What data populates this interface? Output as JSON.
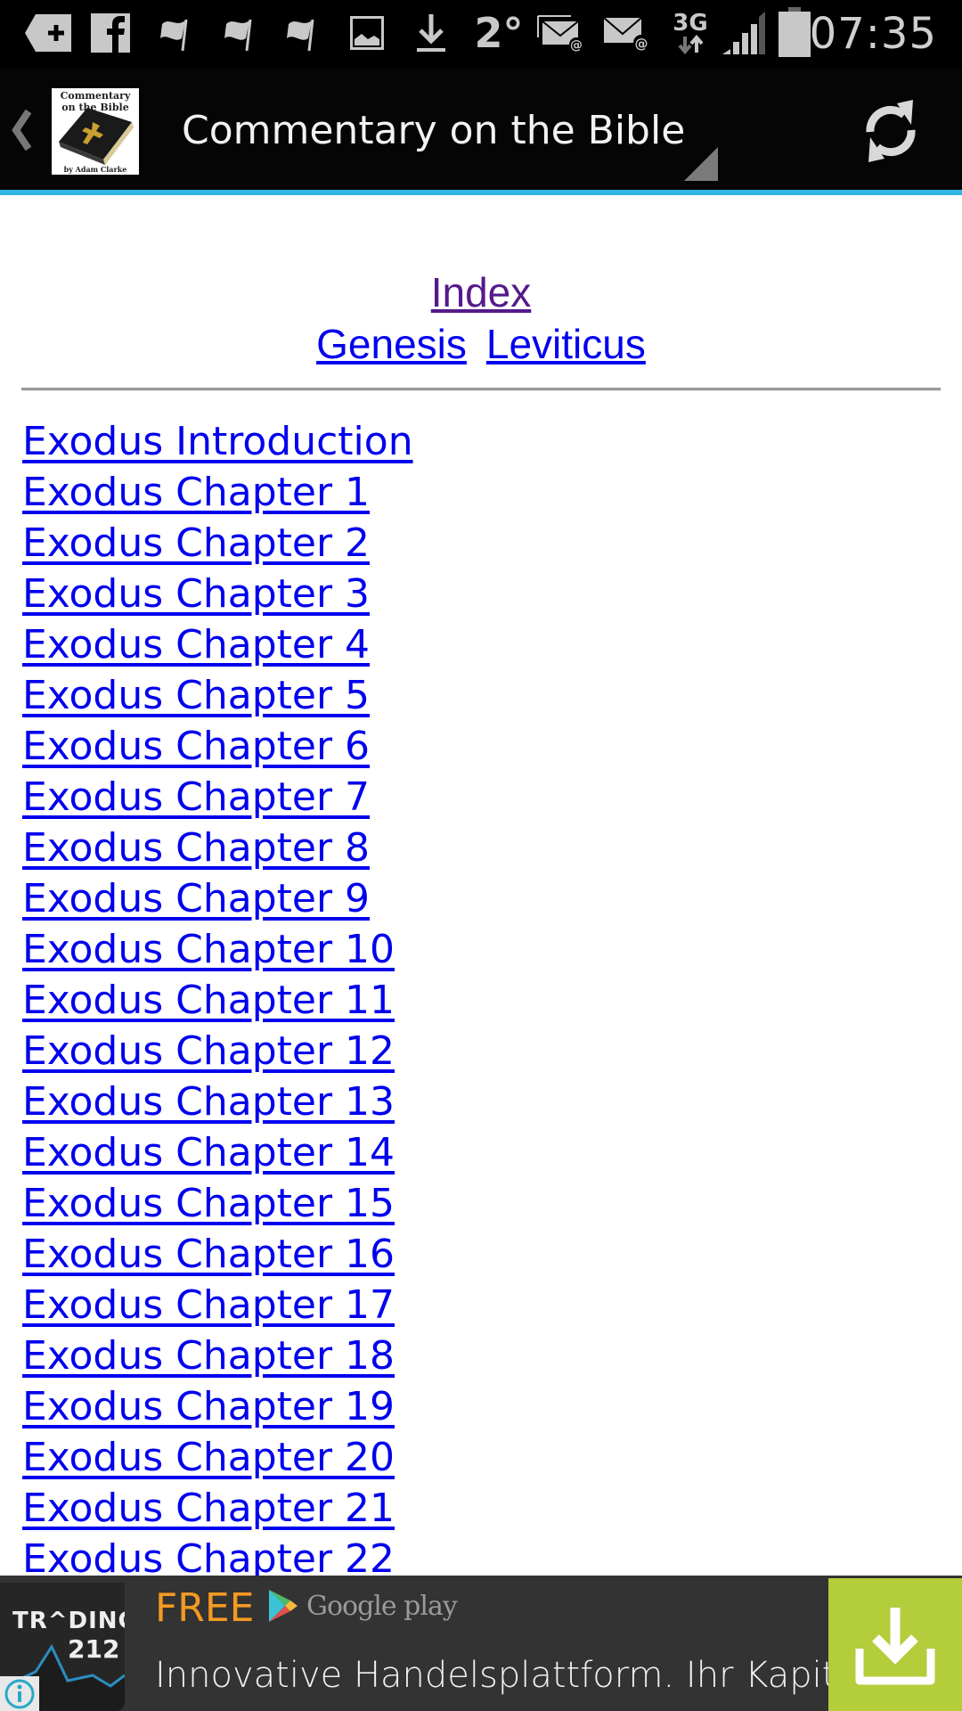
{
  "status_bar": {
    "time": "07:35",
    "temperature": "2°",
    "network": "3G",
    "notification_icons": [
      "add-tag-icon",
      "facebook-icon",
      "flag-icon",
      "flag-icon",
      "flag-icon",
      "image-icon",
      "download-icon",
      "weather-temp",
      "email-stack-icon",
      "email-icon"
    ],
    "system_icons": [
      "3g-data-icon",
      "signal-icon",
      "battery-icon"
    ]
  },
  "action_bar": {
    "title": "Commentary on the Bible",
    "logo": {
      "line1": "Commentary",
      "line2": "on the Bible",
      "byline": "by Adam Clarke"
    },
    "refresh_icon": "refresh-icon",
    "accent_color": "#33b5e5"
  },
  "nav": {
    "index_label": "Index",
    "prev_book": "Genesis",
    "next_book": "Leviticus",
    "visited_color": "#551a8b",
    "link_color": "#0000ee"
  },
  "chapters": [
    "Exodus Introduction",
    "Exodus Chapter 1",
    "Exodus Chapter 2",
    "Exodus Chapter 3",
    "Exodus Chapter 4",
    "Exodus Chapter 5",
    "Exodus Chapter 6",
    "Exodus Chapter 7",
    "Exodus Chapter 8",
    "Exodus Chapter 9",
    "Exodus Chapter 10",
    "Exodus Chapter 11",
    "Exodus Chapter 12",
    "Exodus Chapter 13",
    "Exodus Chapter 14",
    "Exodus Chapter 15",
    "Exodus Chapter 16",
    "Exodus Chapter 17",
    "Exodus Chapter 18",
    "Exodus Chapter 19",
    "Exodus Chapter 20",
    "Exodus Chapter 21",
    "Exodus Chapter 22"
  ],
  "ad": {
    "brand_line1": "TR^DING",
    "brand_line2": "212",
    "price_label": "FREE",
    "store_label": "Google play",
    "text": "Innovative Handelsplattform. Ihr Kapital",
    "info_icon": "info-icon",
    "download_icon": "download-icon",
    "price_color": "#f39a22",
    "button_color": "#b3cd3b"
  }
}
